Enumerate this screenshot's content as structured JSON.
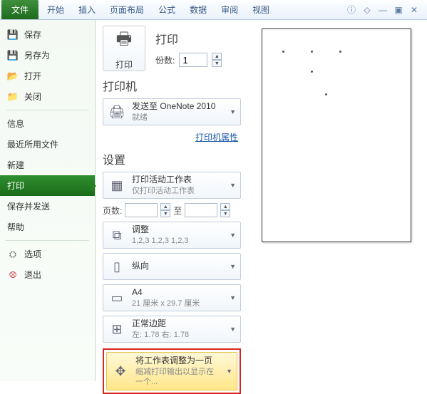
{
  "ribbon": {
    "tabs": [
      "文件",
      "开始",
      "插入",
      "页面布局",
      "公式",
      "数据",
      "审阅",
      "视图"
    ]
  },
  "sidebar": {
    "save": "保存",
    "saveas": "另存为",
    "open": "打开",
    "close": "关闭",
    "info": "信息",
    "recent": "最近所用文件",
    "new": "新建",
    "print": "打印",
    "saveSend": "保存并发送",
    "help": "帮助",
    "options": "选项",
    "exit": "退出"
  },
  "print": {
    "header": "打印",
    "button": "打印",
    "copies_label": "份数:",
    "copies_value": "1",
    "printer_header": "打印机",
    "printer": {
      "name": "发送至 OneNote 2010",
      "status": "就绪"
    },
    "printer_props": "打印机属性",
    "settings_header": "设置",
    "scope": {
      "t1": "打印活动工作表",
      "t2": "仅打印活动工作表"
    },
    "pages": {
      "label": "页数:",
      "to": "至"
    },
    "collate": {
      "t1": "调整",
      "t2": "1,2,3    1,2,3    1,2,3"
    },
    "orient": {
      "t1": "纵向"
    },
    "paper": {
      "t1": "A4",
      "t2": "21 厘米 x 29.7 厘米"
    },
    "margins": {
      "t1": "正常边距",
      "t2": "左: 1.78    右: 1.78"
    },
    "fit": {
      "t1": "将工作表调整为一页",
      "t2": "缩减打印输出以显示在一个..."
    }
  }
}
